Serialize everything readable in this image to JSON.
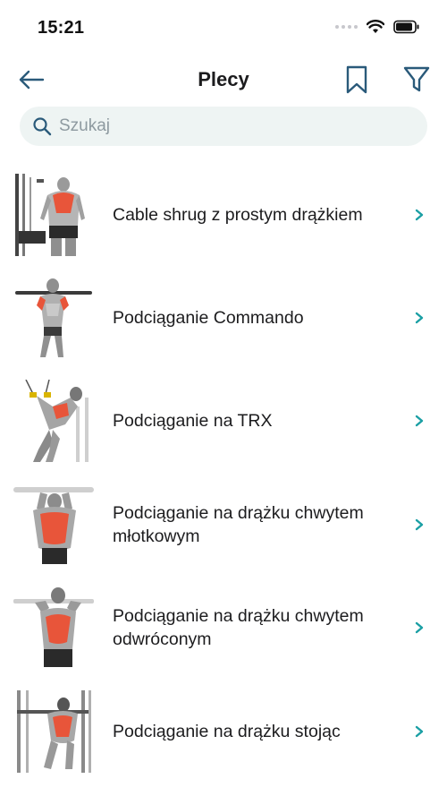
{
  "status": {
    "time": "15:21"
  },
  "header": {
    "title": "Plecy"
  },
  "search": {
    "placeholder": "Szukaj",
    "value": ""
  },
  "exercises": [
    {
      "name": "Cable shrug z prostym drążkiem"
    },
    {
      "name": "Podciąganie Commando"
    },
    {
      "name": "Podciąganie na TRX"
    },
    {
      "name": "Podciąganie na drążku chwytem młotkowym"
    },
    {
      "name": "Podciąganie na drążku chwytem odwróconym"
    },
    {
      "name": "Podciąganie na drążku stojąc"
    }
  ],
  "icons": {
    "back": "arrow-left-icon",
    "bookmark": "bookmark-icon",
    "filter": "filter-icon",
    "search": "search-icon",
    "chevron": "chevron-right-icon"
  },
  "colors": {
    "accent": "#1a9fa4",
    "nav_icon": "#2a5a7a",
    "muscle": "#e8553a",
    "search_bg": "#eef4f3"
  }
}
